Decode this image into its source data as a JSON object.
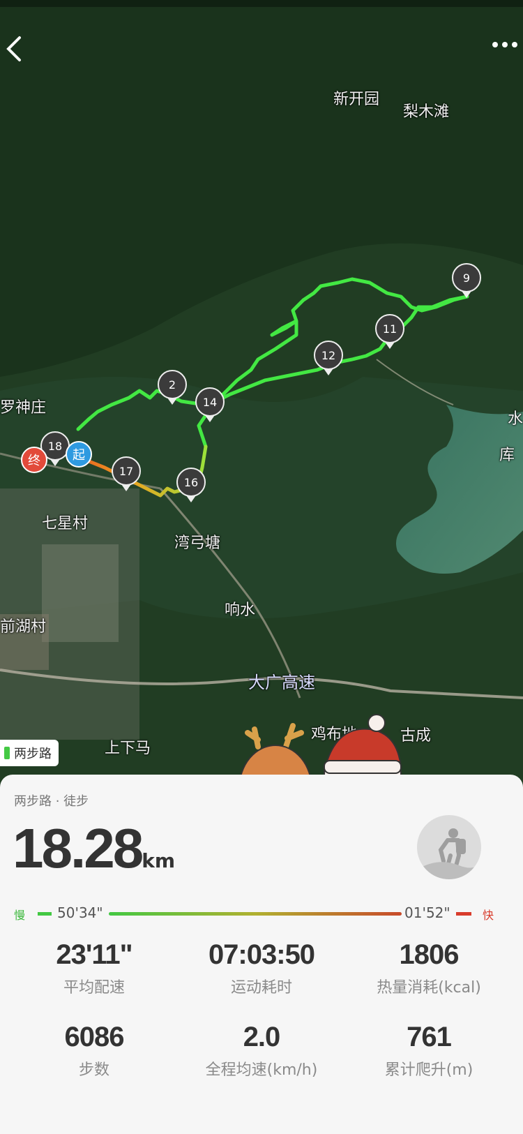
{
  "colors": {
    "track_green": "#43e843",
    "track_red": "#e23c22",
    "end_badge": "#e24a3a",
    "start_badge": "#2e9ae0",
    "pace_slow": "#3cb83c",
    "pace_fast": "#d83c2c"
  },
  "map": {
    "labels": {
      "xinkaiyuan": "新开园",
      "limutan": "梨木滩",
      "luoshenzhuang": "罗神庄",
      "qixingcun": "七星村",
      "wangaitang": "湾弓塘",
      "xiangshui": "响水",
      "highway": "大广高速",
      "shangxiama": "上下马",
      "jibudi": "鸡布地",
      "gucheng": "古成",
      "hucun": "前湖村",
      "edge_shui": "水",
      "edge_ku": "库"
    },
    "waypoints": [
      "9",
      "11",
      "12",
      "2",
      "14",
      "18",
      "17",
      "16"
    ],
    "end_label": "终",
    "start_label": "起"
  },
  "header": {
    "back_icon": "chevron-left-icon",
    "more_icon": "more-dots-icon"
  },
  "source_chip": {
    "label": "两步路"
  },
  "summary": {
    "subtitle": "两步路 · 徒步",
    "distance_value": "18.28",
    "distance_unit": "km",
    "pace_slow_label": "慢",
    "pace_fast_label": "快",
    "pace_slowest": "50'34\"",
    "pace_fastest": "01'52\""
  },
  "stats": [
    {
      "value": "23'11\"",
      "label": "平均配速"
    },
    {
      "value": "07:03:50",
      "label": "运动耗时"
    },
    {
      "value": "1806",
      "label": "热量消耗(kcal)"
    },
    {
      "value": "6086",
      "label": "步数"
    },
    {
      "value": "2.0",
      "label": "全程均速(km/h)"
    },
    {
      "value": "761",
      "label": "累计爬升(m)"
    }
  ]
}
